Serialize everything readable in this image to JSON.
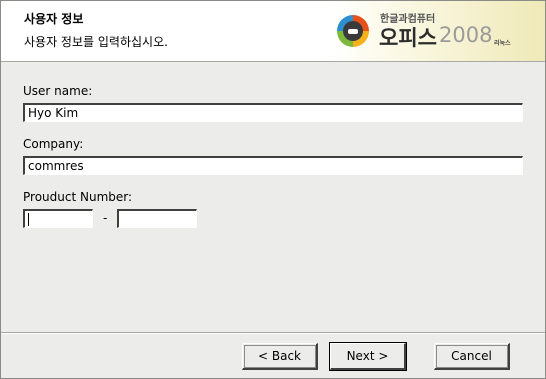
{
  "header": {
    "title": "사용자 정보",
    "subtitle": "사용자 정보를 입력하십시오."
  },
  "brand": {
    "small": "한글과컴퓨터",
    "name": "오피스",
    "year": "2008",
    "tag": "리눅스"
  },
  "form": {
    "user_label": "User name:",
    "user_value": "Hyo Kim",
    "company_label": "Company:",
    "company_value": "commres",
    "product_label": "Prouduct Number:",
    "product_part1": "",
    "product_separator": "-",
    "product_part2": ""
  },
  "buttons": {
    "back_label": "< Back",
    "next_label": "Next >",
    "cancel_label": "Cancel"
  },
  "colors": {
    "window_bg": "#ececea",
    "header_bg": "#ffffff"
  }
}
